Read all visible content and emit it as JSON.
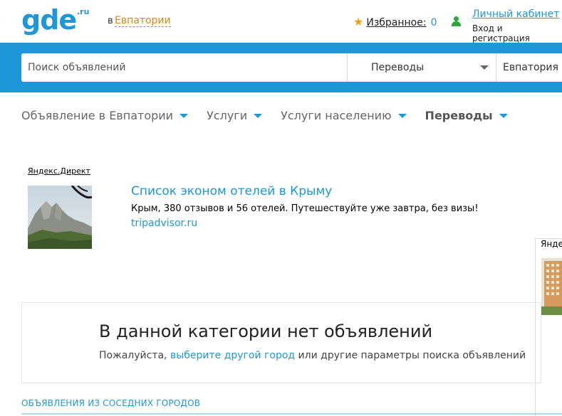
{
  "header": {
    "logo": "gde",
    "logo_suffix": ".ru",
    "city_prefix": "в",
    "city": "Евпатории",
    "favorites_label": "Избранное:",
    "favorites_count": "0",
    "cabinet_label": "Личный кабинет",
    "login_label": "Вход и регистрация"
  },
  "search": {
    "placeholder": "Поиск объявлений",
    "category": "Переводы",
    "city": "Евпатория"
  },
  "breadcrumbs": [
    {
      "label": "Объявление в Евпатории"
    },
    {
      "label": "Услуги"
    },
    {
      "label": "Услуги населению"
    },
    {
      "label": "Переводы"
    }
  ],
  "ad": {
    "tag": "Яндекс.Директ",
    "title": "Список эконом отелей в Крыму",
    "text": "Крым, 380 отзывов и 56 отелей. Путешествуйте уже завтра, без визы!",
    "domain": "tripadvisor.ru"
  },
  "side_ad": {
    "tag": "Янде"
  },
  "empty": {
    "title": "В данной категории нет объявлений",
    "sub_before": "Пожалуйста, ",
    "sub_link": "выберите другой город",
    "sub_after": " или другие параметры поиска объявлений"
  },
  "nearby": {
    "label": "ОБЪЯВЛЕНИЯ ИЗ СОСЕДНИХ ГОРОДОВ"
  },
  "colors": {
    "brand_blue": "#1e97d9",
    "city_orange": "#d8861c",
    "star": "#f2a01a",
    "user_green": "#2aa73c"
  }
}
